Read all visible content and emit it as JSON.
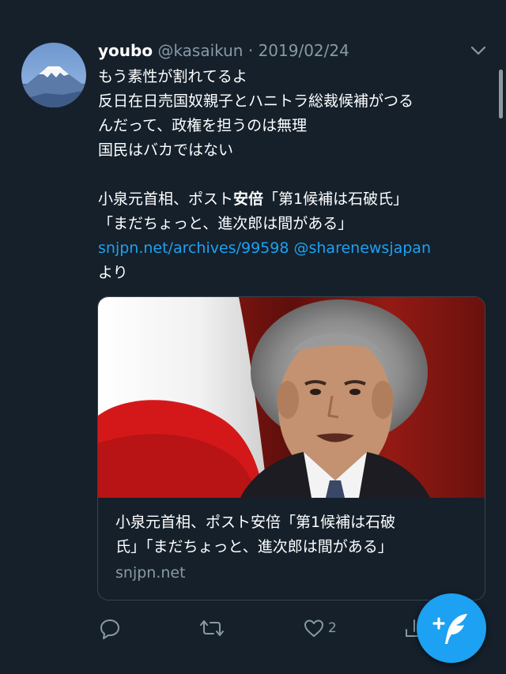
{
  "tweet": {
    "name": "youbo",
    "handle": "@kasaikun",
    "separator": "·",
    "date": "2019/02/24",
    "lines": [
      "もう素性が割れてるよ",
      "反日在日売国奴親子とハニトラ総裁候補がつる",
      "んだって、政権を担うのは無理",
      "国民はバカではない"
    ],
    "quote_prefix": "小泉元首相、ポスト",
    "quote_bold": "安倍",
    "quote_suffix": "「第1候補は石破氏」",
    "quote_line2": "「まだちょっと、進次郎は間がある」",
    "link_url": "snjpn.net/archives/99598",
    "link_mention": "@sharenewsjapan",
    "link_tail": "より"
  },
  "card": {
    "title_line1": "小泉元首相、ポスト安倍「第1候補は石破",
    "title_line2": "氏」「まだちょっと、進次郎は間がある」",
    "domain": "snjpn.net"
  },
  "actions": {
    "like_count": "2"
  },
  "icons": {
    "menu": "chevron-down-icon",
    "reply": "reply-icon",
    "retweet": "retweet-icon",
    "like": "heart-icon",
    "share": "share-icon",
    "compose": "compose-icon"
  },
  "colors": {
    "background": "#15202b",
    "accent": "#1da1f2",
    "secondary_text": "#8899a6",
    "border": "#38444d"
  }
}
